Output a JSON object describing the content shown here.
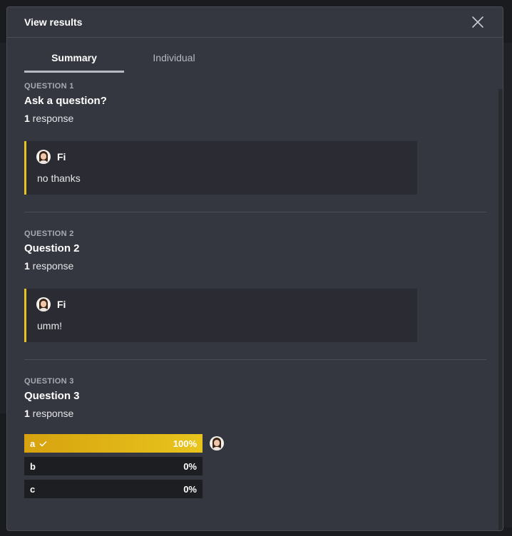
{
  "modal": {
    "title": "View results",
    "close_icon": "close-icon"
  },
  "tabs": [
    {
      "label": "Summary",
      "active": true
    },
    {
      "label": "Individual",
      "active": false
    }
  ],
  "questions": [
    {
      "label": "QUESTION 1",
      "title": "Ask a question?",
      "count": "1",
      "count_suffix": " response",
      "responses": [
        {
          "name": "Fi",
          "text": "no thanks"
        }
      ]
    },
    {
      "label": "QUESTION 2",
      "title": "Question 2",
      "count": "1",
      "count_suffix": " response",
      "responses": [
        {
          "name": "Fi",
          "text": "umm!"
        }
      ]
    },
    {
      "label": "QUESTION 3",
      "title": "Question 3",
      "count": "1",
      "count_suffix": " response",
      "options": [
        {
          "label": "a",
          "correct": true,
          "percent_label": "100%",
          "percent": 100,
          "voters": 1
        },
        {
          "label": "b",
          "correct": false,
          "percent_label": "0%",
          "percent": 0,
          "voters": 0
        },
        {
          "label": "c",
          "correct": false,
          "percent_label": "0%",
          "percent": 0,
          "voters": 0
        }
      ]
    }
  ],
  "colors": {
    "accent": "#e9c21c",
    "accent_start": "#d7a20f",
    "bar_bg": "#1d1e22",
    "modal_bg": "#353740",
    "card_bg": "#2b2c33"
  }
}
